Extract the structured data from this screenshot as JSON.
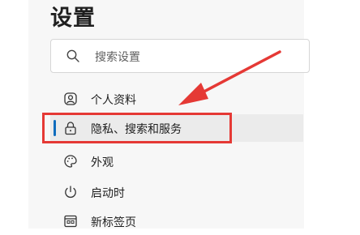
{
  "header": {
    "title": "设置"
  },
  "search": {
    "placeholder": "搜索设置"
  },
  "sidebar": {
    "items": [
      {
        "label": "个人资料",
        "icon": "profile-icon"
      },
      {
        "label": "隐私、搜索和服务",
        "icon": "lock-icon",
        "active": true
      },
      {
        "label": "外观",
        "icon": "palette-icon"
      },
      {
        "label": "启动时",
        "icon": "power-icon"
      },
      {
        "label": "新标签页",
        "icon": "new-tab-icon"
      }
    ]
  },
  "annotation": {
    "color": "#e53935"
  },
  "colors": {
    "accent": "#0f6cbd",
    "active_bg": "#ebebeb",
    "panel_bg": "#f7f7f7"
  }
}
